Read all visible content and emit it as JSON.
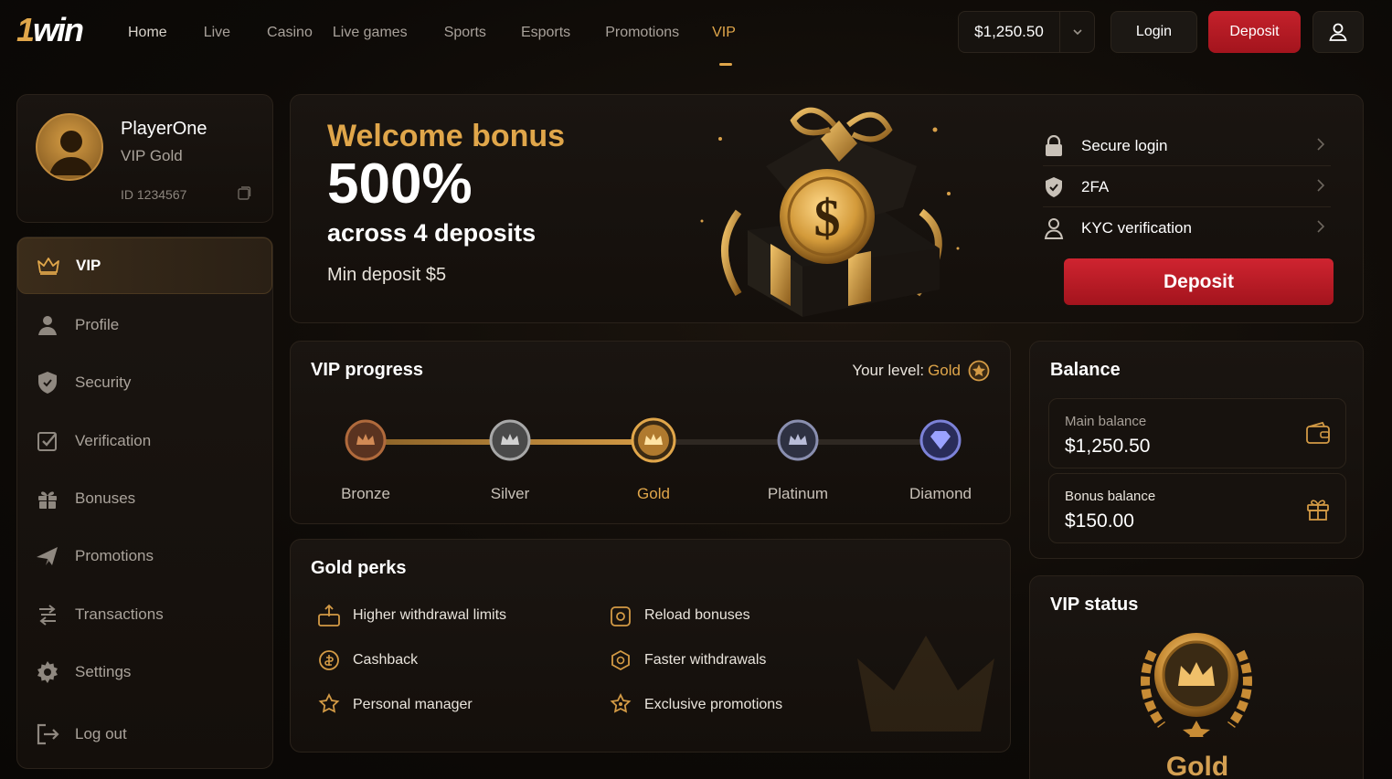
{
  "brand": {
    "logo_prefix": "1",
    "logo_rest": "win"
  },
  "nav": {
    "items": [
      {
        "label": "Home"
      },
      {
        "label": "Live"
      },
      {
        "label": "Casino"
      },
      {
        "label": "Live games"
      },
      {
        "label": "Sports"
      },
      {
        "label": "Esports"
      },
      {
        "label": "Promotions"
      },
      {
        "label": "VIP"
      }
    ],
    "active": "VIP"
  },
  "header": {
    "balance": "$1,250.50",
    "login_label": "Login",
    "deposit_label": "Deposit",
    "user_icon": "user-icon"
  },
  "profile": {
    "name": "PlayerOne",
    "level": "VIP Gold",
    "id": "ID 1234567"
  },
  "sidebar": {
    "items": [
      {
        "label": "VIP",
        "icon": "crown-icon"
      },
      {
        "label": "Profile",
        "icon": "user-icon"
      },
      {
        "label": "Security",
        "icon": "shield-icon"
      },
      {
        "label": "Verification",
        "icon": "checkbox-icon"
      },
      {
        "label": "Bonuses",
        "icon": "gift-icon"
      },
      {
        "label": "Promotions",
        "icon": "megaphone-icon"
      },
      {
        "label": "Transactions",
        "icon": "transfer-icon"
      },
      {
        "label": "Settings",
        "icon": "gear-icon"
      },
      {
        "label": "Log out",
        "icon": "logout-icon"
      }
    ]
  },
  "hero": {
    "title": "Welcome bonus",
    "percent": "500%",
    "subtitle": "across 4 deposits",
    "min_deposit": "Min deposit $5",
    "links": [
      {
        "label": "Secure login",
        "icon": "lock-icon"
      },
      {
        "label": "2FA",
        "icon": "shield-icon"
      },
      {
        "label": "KYC verification",
        "icon": "user-icon"
      }
    ],
    "deposit_label": "Deposit"
  },
  "vip_progress": {
    "title": "VIP progress",
    "your_level_label": "Your level:",
    "your_level": "Gold",
    "tiers": [
      "Bronze",
      "Silver",
      "Gold",
      "Platinum",
      "Diamond"
    ],
    "current_tier_index": 2
  },
  "perks": {
    "title": "Gold perks",
    "items": [
      {
        "label": "Higher withdrawal limits",
        "icon": "withdraw-icon"
      },
      {
        "label": "Reload bonuses",
        "icon": "reload-gift-icon"
      },
      {
        "label": "Cashback",
        "icon": "cashback-icon"
      },
      {
        "label": "Faster withdrawals",
        "icon": "fast-icon"
      },
      {
        "label": "Personal manager",
        "icon": "manager-icon"
      },
      {
        "label": "Exclusive promotions",
        "icon": "star-icon"
      }
    ]
  },
  "balance": {
    "title": "Balance",
    "main_label": "Main balance",
    "main_value": "$1,250.50",
    "bonus_label": "Bonus balance",
    "bonus_value": "$150.00"
  },
  "vip_status": {
    "title": "VIP status",
    "level": "Gold"
  },
  "colors": {
    "accent_gold": "#e0a64a",
    "deposit_red": "#c4212b",
    "background": "#0e0b08"
  }
}
